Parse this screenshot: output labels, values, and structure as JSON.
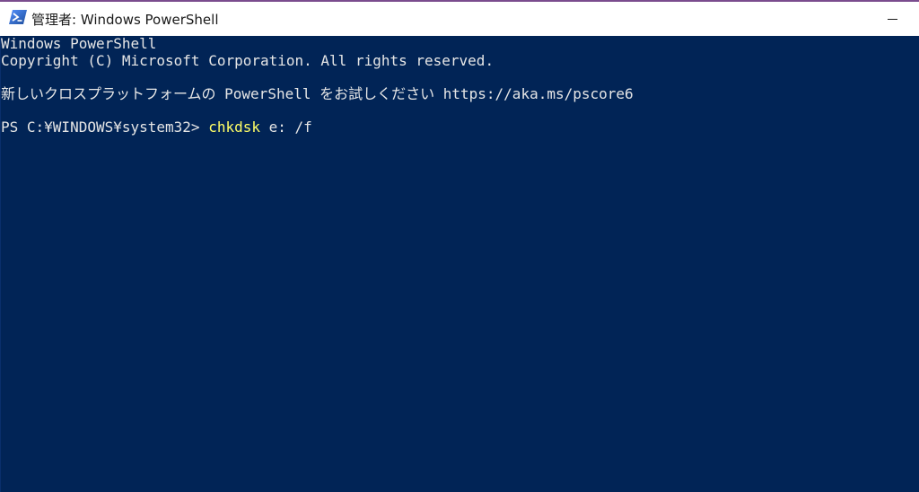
{
  "window": {
    "title": "管理者: Windows PowerShell",
    "icon": "powershell-icon"
  },
  "console": {
    "background": "#012456",
    "foreground": "#e6e6e6",
    "command_color": "#ffff66",
    "line1": "Windows PowerShell",
    "line2": "Copyright (C) Microsoft Corporation. All rights reserved.",
    "line3": "新しいクロスプラットフォームの PowerShell をお試しください https://aka.ms/pscore6",
    "prompt": "PS C:¥WINDOWS¥system32> ",
    "command": "chkdsk",
    "args": " e: /f"
  }
}
